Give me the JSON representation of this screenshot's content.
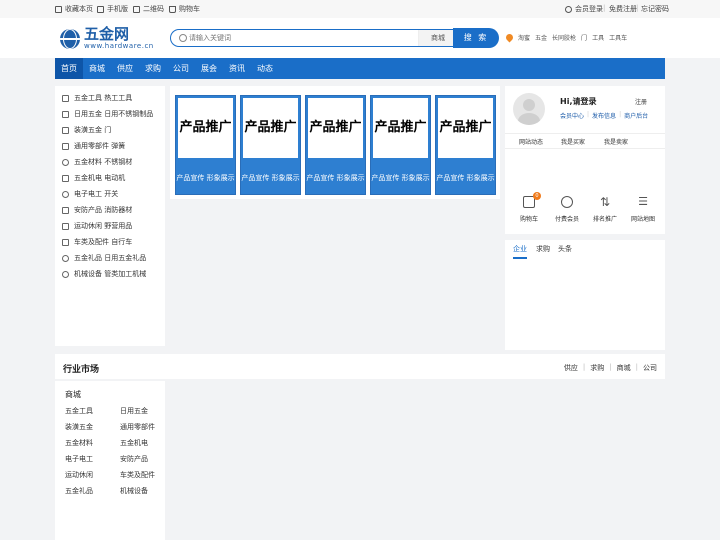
{
  "topbar": {
    "favorite": "收藏本页",
    "mobile": "手机版",
    "qrcode": "二维码",
    "cart": "购物车",
    "login": "会员登录",
    "register": "免费注册",
    "forgot": "忘记密码"
  },
  "logo": {
    "title": "五金网",
    "subtitle": "www.hardware.cn"
  },
  "search": {
    "placeholder": "请输入关键词",
    "category": "商城",
    "button": "搜 索"
  },
  "hotwords": [
    "淘蜜",
    "五金",
    "长同胶枪",
    "门",
    "工具",
    "工具车"
  ],
  "nav": [
    "首页",
    "商城",
    "供应",
    "求购",
    "公司",
    "展会",
    "资讯",
    "动态"
  ],
  "categories": [
    "五金工具 热工工具",
    "日用五金 日用不锈钢制品",
    "装潢五金 门",
    "通用零部件 弹簧",
    "五金材料 不锈钢材",
    "五金机电 电动机",
    "电子电工 开关",
    "安防产品 消防器材",
    "运动休闲 野营用品",
    "车类及配件 自行车",
    "五金礼品 日用五金礼品",
    "机械设备 管类加工机械"
  ],
  "ads": [
    {
      "main": "产品推广",
      "sub": "产品宣传 形象展示"
    },
    {
      "main": "产品推广",
      "sub": "产品宣传 形象展示"
    },
    {
      "main": "产品推广",
      "sub": "产品宣传 形象展示"
    },
    {
      "main": "产品推广",
      "sub": "产品宣传 形象展示"
    },
    {
      "main": "产品推广",
      "sub": "产品宣传 形象展示"
    }
  ],
  "user": {
    "greeting": "Hi,请登录",
    "register": "注册",
    "links": [
      "会员中心",
      "发布信息",
      "商户后台"
    ],
    "tabs": [
      "网站动态",
      "我是买家",
      "我是卖家"
    ],
    "quick": [
      {
        "label": "购物车",
        "badge": "0"
      },
      {
        "label": "付费会员"
      },
      {
        "label": "排名推广"
      },
      {
        "label": "网站地图"
      }
    ]
  },
  "news": {
    "tabs": [
      "企业",
      "求购",
      "头条"
    ]
  },
  "market": {
    "title": "行业市场",
    "links": [
      "供应",
      "求购",
      "商城",
      "公司"
    ]
  },
  "mall": {
    "title": "商城",
    "items": [
      [
        "五金工具",
        "日用五金"
      ],
      [
        "装潢五金",
        "通用零部件"
      ],
      [
        "五金材料",
        "五金机电"
      ],
      [
        "电子电工",
        "安防产品"
      ],
      [
        "运动休闲",
        "车类及配件"
      ],
      [
        "五金礼品",
        "机械设备"
      ]
    ]
  },
  "colors": {
    "brand": "#1a6ec8",
    "brand_dark": "#0e55a8",
    "accent": "#f07a1a"
  }
}
